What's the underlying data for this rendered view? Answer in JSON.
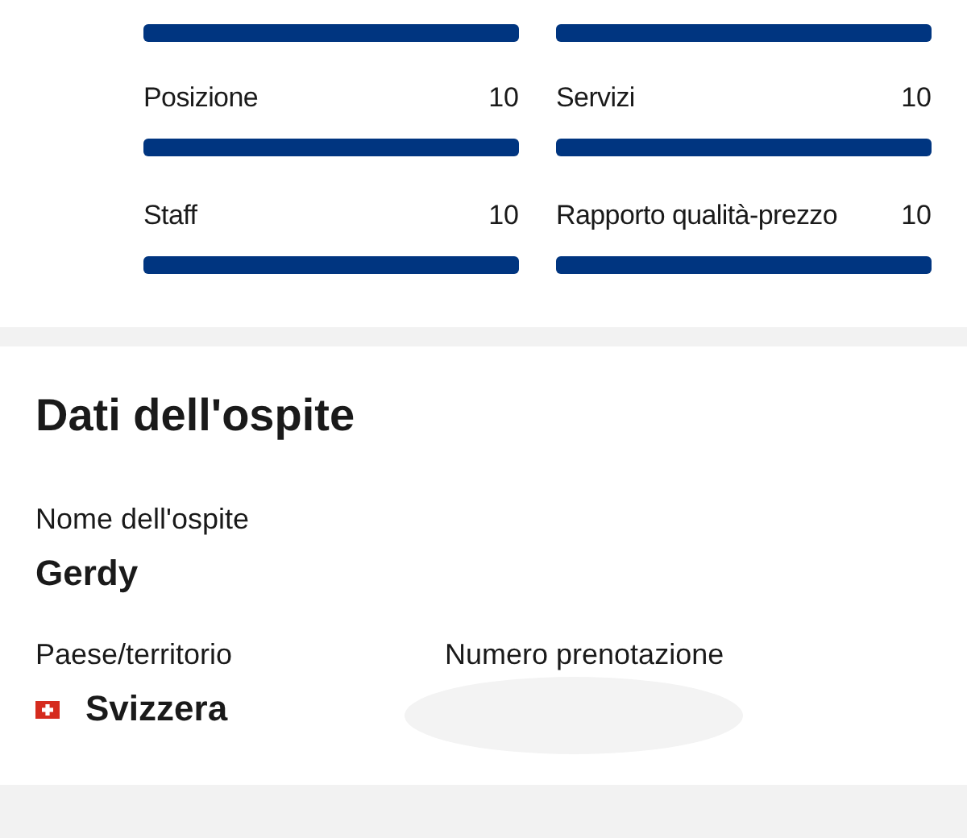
{
  "ratings": {
    "cut_bars": [
      {
        "level": 1
      },
      {
        "level": 1
      }
    ],
    "items": [
      {
        "label": "Posizione",
        "score": "10",
        "level": 1
      },
      {
        "label": "Servizi",
        "score": "10",
        "level": 1
      },
      {
        "label": "Staff",
        "score": "10",
        "level": 1
      },
      {
        "label": "Rapporto qualità-prezzo",
        "score": "10",
        "level": 1
      }
    ]
  },
  "guest": {
    "title": "Dati dell'ospite",
    "name_label": "Nome dell'ospite",
    "name": "Gerdy",
    "country_label": "Paese/territorio",
    "country": "Svizzera",
    "booking_label": "Numero prenotazione"
  }
}
